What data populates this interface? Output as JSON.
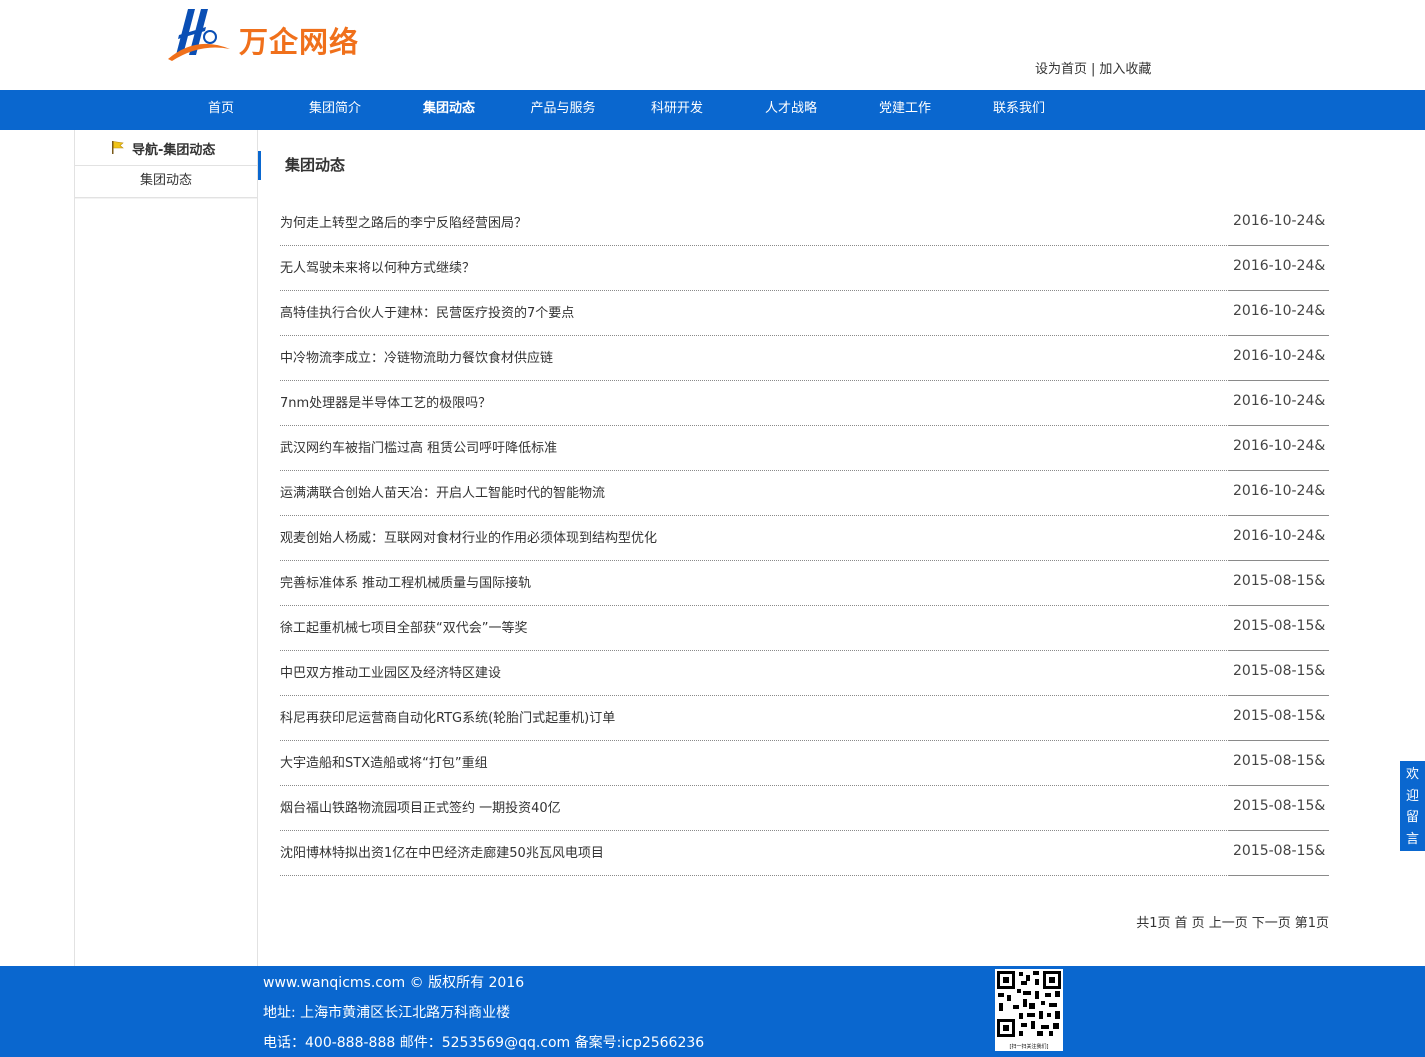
{
  "header": {
    "logo_text": "万企网络",
    "logo_color": "#f0701b",
    "set_homepage": "设为首页",
    "separator": "|",
    "add_favorite": "加入收藏"
  },
  "nav": {
    "background": "#0a67cf",
    "items": [
      {
        "label": "首页",
        "active": false
      },
      {
        "label": "集团简介",
        "active": false
      },
      {
        "label": "集团动态",
        "active": true
      },
      {
        "label": "产品与服务",
        "active": false
      },
      {
        "label": "科研开发",
        "active": false
      },
      {
        "label": "人才战略",
        "active": false
      },
      {
        "label": "党建工作",
        "active": false
      },
      {
        "label": "联系我们",
        "active": false
      }
    ]
  },
  "sidebar": {
    "title": "导航-集团动态",
    "items": [
      "集团动态"
    ]
  },
  "content": {
    "title": "集团动态",
    "news": [
      {
        "title": "为何走上转型之路后的李宁反陷经营困局？",
        "date": "2016-10-24&"
      },
      {
        "title": "无人驾驶未来将以何种方式继续？",
        "date": "2016-10-24&"
      },
      {
        "title": "高特佳执行合伙人于建林：民营医疗投资的7个要点",
        "date": "2016-10-24&"
      },
      {
        "title": "中冷物流李成立：冷链物流助力餐饮食材供应链",
        "date": "2016-10-24&"
      },
      {
        "title": "7nm处理器是半导体工艺的极限吗？",
        "date": "2016-10-24&"
      },
      {
        "title": "武汉网约车被指门槛过高 租赁公司呼吁降低标准",
        "date": "2016-10-24&"
      },
      {
        "title": "运满满联合创始人苗天冶：开启人工智能时代的智能物流",
        "date": "2016-10-24&"
      },
      {
        "title": "观麦创始人杨威：互联网对食材行业的作用必须体现到结构型优化",
        "date": "2016-10-24&"
      },
      {
        "title": "完善标准体系 推动工程机械质量与国际接轨",
        "date": "2015-08-15&"
      },
      {
        "title": "徐工起重机械七项目全部获“双代会”一等奖",
        "date": "2015-08-15&"
      },
      {
        "title": "中巴双方推动工业园区及经济特区建设",
        "date": "2015-08-15&"
      },
      {
        "title": "科尼再获印尼运营商自动化RTG系统(轮胎门式起重机)订单",
        "date": "2015-08-15&"
      },
      {
        "title": "大宇造船和STX造船或将“打包”重组",
        "date": "2015-08-15&"
      },
      {
        "title": "烟台福山铁路物流园项目正式签约 一期投资40亿",
        "date": "2015-08-15&"
      },
      {
        "title": "沈阳博林特拟出资1亿在中巴经济走廊建50兆瓦风电项目",
        "date": "2015-08-15&"
      }
    ],
    "pager": {
      "total": "共1页",
      "first": "首 页",
      "prev": "上一页",
      "next": "下一页",
      "current": "第1页"
    }
  },
  "float_tab": {
    "chars": [
      "欢",
      "迎",
      "留",
      "言"
    ]
  },
  "footer": {
    "copyright": "www.wanqicms.com © 版权所有 2016",
    "address": "地址: 上海市黄浦区长江北路万科商业楼",
    "contact": "电话：400-888-888 邮件：5253569@qq.com 备案号:icp2566236",
    "qr_caption": "[扫一扫关注我们]"
  }
}
